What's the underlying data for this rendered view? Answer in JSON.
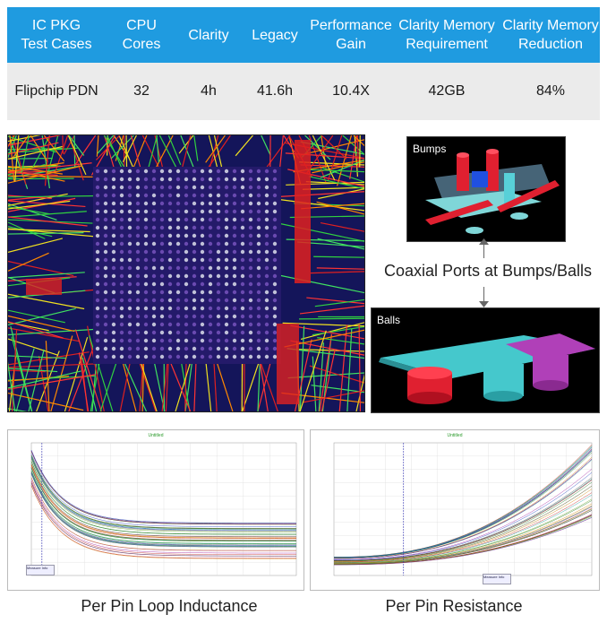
{
  "table": {
    "headers": [
      "IC PKG\nTest Cases",
      "CPU\nCores",
      "Clarity",
      "Legacy",
      "Performance\nGain",
      "Clarity Memory\nRequirement",
      "Clarity Memory\nReduction"
    ],
    "row": [
      "Flipchip PDN",
      "32",
      "4h",
      "41.6h",
      "10.4X",
      "42GB",
      "84%"
    ]
  },
  "panels": {
    "bumps_label": "Bumps",
    "balls_label": "Balls",
    "coax_label": "Coaxial Ports at Bumps/Balls"
  },
  "graphs": {
    "left": {
      "title": "Untitled",
      "caption": "Per Pin Loop Inductance",
      "legend_label": "Measure Info"
    },
    "right": {
      "title": "Untitled",
      "caption": "Per Pin Resistance",
      "legend_label": "Measure Info"
    }
  },
  "colors": {
    "header_blue": "#1f9be0",
    "row_gray": "#ebebeb",
    "layout_bg": "#14155a"
  }
}
